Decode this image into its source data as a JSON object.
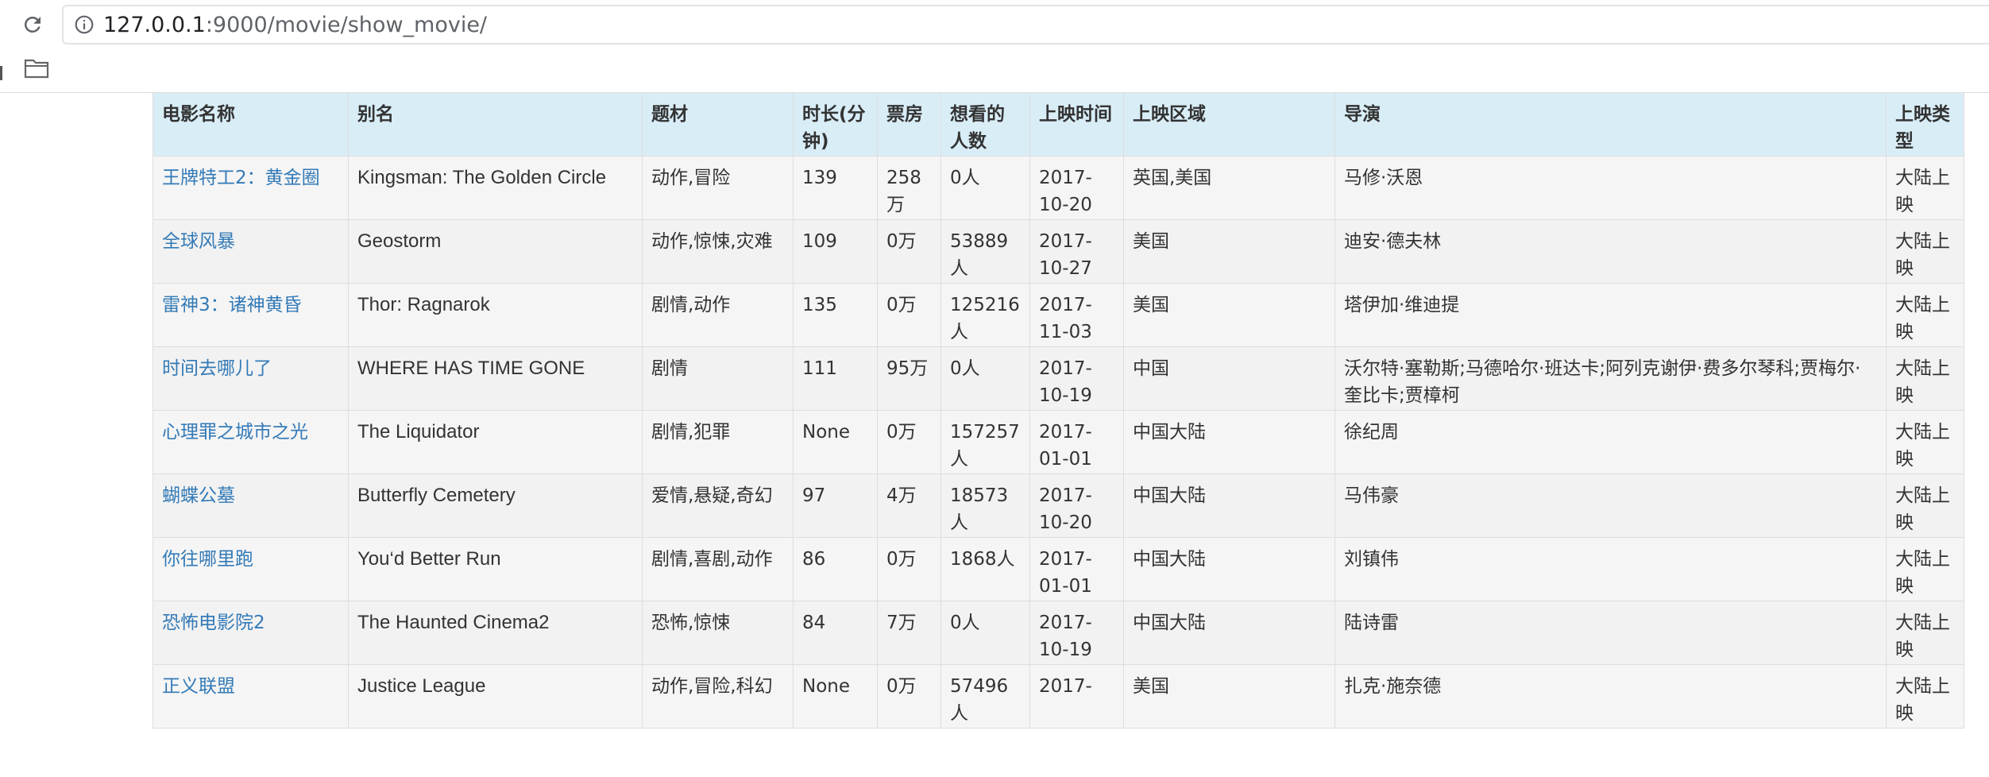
{
  "browser": {
    "url_host": "127.0.0.1",
    "url_rest": ":9000/movie/show_movie/"
  },
  "table": {
    "headers": [
      "电影名称",
      "别名",
      "题材",
      "时长(分钟)",
      "票房",
      "想看的人数",
      "上映时间",
      "上映区域",
      "导演",
      "上映类型"
    ],
    "rows": [
      [
        "王牌特工2：黄金圈",
        "Kingsman: The Golden Circle",
        "动作,冒险",
        "139",
        "258万",
        "0人",
        "2017-10-20",
        "英国,美国",
        "马修·沃恩",
        "大陆上映"
      ],
      [
        "全球风暴",
        "Geostorm",
        "动作,惊悚,灾难",
        "109",
        "0万",
        "53889人",
        "2017-10-27",
        "美国",
        "迪安·德夫林",
        "大陆上映"
      ],
      [
        "雷神3：诸神黄昏",
        "Thor: Ragnarok",
        "剧情,动作",
        "135",
        "0万",
        "125216人",
        "2017-11-03",
        "美国",
        "塔伊加·维迪提",
        "大陆上映"
      ],
      [
        "时间去哪儿了",
        "WHERE HAS TIME GONE",
        "剧情",
        "111",
        "95万",
        "0人",
        "2017-10-19",
        "中国",
        "沃尔特·塞勒斯;马德哈尔·班达卡;阿列克谢伊·费多尔琴科;贾梅尔·奎比卡;贾樟柯",
        "大陆上映"
      ],
      [
        "心理罪之城市之光",
        "The Liquidator",
        "剧情,犯罪",
        "None",
        "0万",
        "157257人",
        "2017-01-01",
        "中国大陆",
        "徐纪周",
        "大陆上映"
      ],
      [
        "蝴蝶公墓",
        "Butterfly Cemetery",
        "爱情,悬疑,奇幻",
        "97",
        "4万",
        "18573人",
        "2017-10-20",
        "中国大陆",
        "马伟豪",
        "大陆上映"
      ],
      [
        "你往哪里跑",
        "You‘d Better Run",
        "剧情,喜剧,动作",
        "86",
        "0万",
        "1868人",
        "2017-01-01",
        "中国大陆",
        "刘镇伟",
        "大陆上映"
      ],
      [
        "恐怖电影院2",
        "The Haunted Cinema2",
        "恐怖,惊悚",
        "84",
        "7万",
        "0人",
        "2017-10-19",
        "中国大陆",
        "陆诗雷",
        "大陆上映"
      ],
      [
        "正义联盟",
        "Justice League",
        "动作,冒险,科幻",
        "None",
        "0万",
        "57496人",
        "2017-",
        "美国",
        "扎克·施奈德",
        "大陆上映"
      ]
    ]
  }
}
